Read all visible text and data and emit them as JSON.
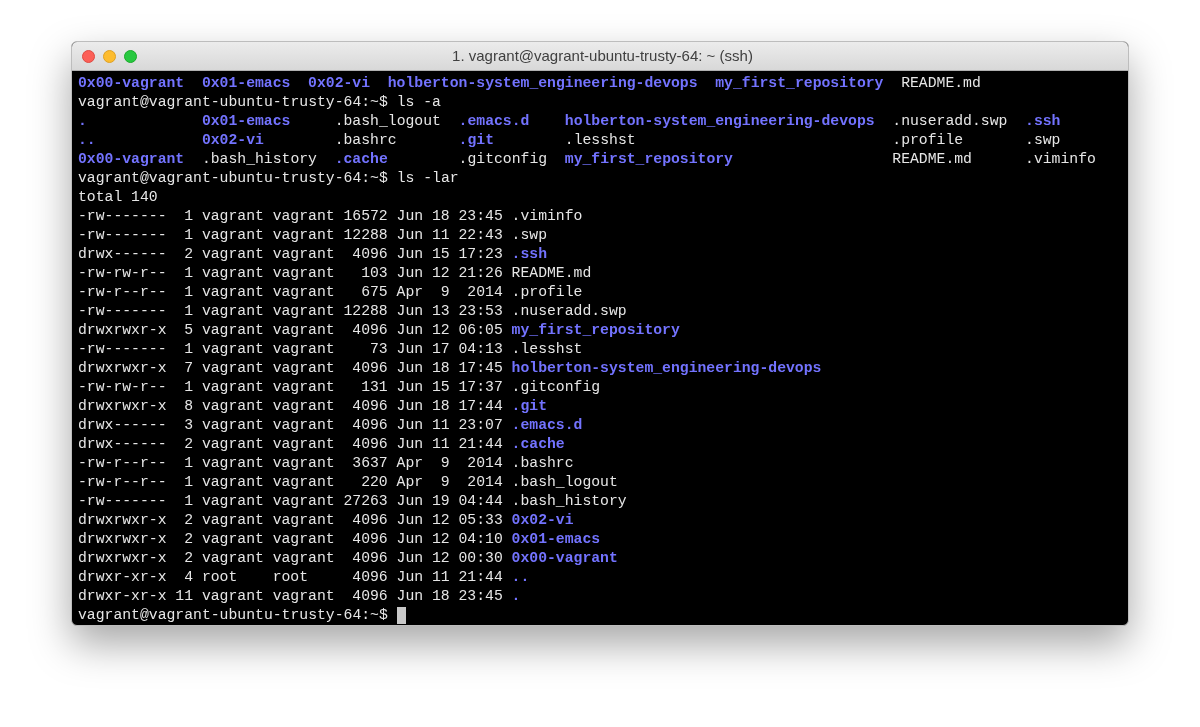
{
  "window": {
    "title": "1. vagrant@vagrant-ubuntu-trusty-64: ~ (ssh)"
  },
  "terminal": {
    "lines": [
      {
        "kind": "row",
        "items": [
          {
            "text": "0x00-vagrant",
            "dir": true
          },
          {
            "text": "0x01-emacs",
            "dir": true
          },
          {
            "text": "0x02-vi",
            "dir": true
          },
          {
            "text": "holberton-system_engineering-devops",
            "dir": true
          },
          {
            "text": "my_first_repository",
            "dir": true
          },
          {
            "text": "README.md",
            "dir": false
          }
        ]
      },
      {
        "kind": "prompt",
        "prompt": "vagrant@vagrant-ubuntu-trusty-64:~$",
        "command": "ls -a",
        "cursor": false
      },
      {
        "kind": "grid",
        "rows": [
          [
            {
              "text": ".",
              "dir": true
            },
            {
              "text": "0x01-emacs",
              "dir": true
            },
            {
              "text": ".bash_logout",
              "dir": false
            },
            {
              "text": ".emacs.d",
              "dir": true
            },
            {
              "text": "holberton-system_engineering-devops",
              "dir": true
            },
            {
              "text": ".nuseradd.swp",
              "dir": false
            },
            {
              "text": ".ssh",
              "dir": true
            }
          ],
          [
            {
              "text": "..",
              "dir": true
            },
            {
              "text": "0x02-vi",
              "dir": true
            },
            {
              "text": ".bashrc",
              "dir": false
            },
            {
              "text": ".git",
              "dir": true
            },
            {
              "text": ".lesshst",
              "dir": false
            },
            {
              "text": ".profile",
              "dir": false
            },
            {
              "text": ".swp",
              "dir": false
            }
          ],
          [
            {
              "text": "0x00-vagrant",
              "dir": true
            },
            {
              "text": ".bash_history",
              "dir": false
            },
            {
              "text": ".cache",
              "dir": true
            },
            {
              "text": ".gitconfig",
              "dir": false
            },
            {
              "text": "my_first_repository",
              "dir": true
            },
            {
              "text": "README.md",
              "dir": false
            },
            {
              "text": ".viminfo",
              "dir": false
            }
          ]
        ]
      },
      {
        "kind": "prompt",
        "prompt": "vagrant@vagrant-ubuntu-trusty-64:~$",
        "command": "ls -lar",
        "cursor": false
      },
      {
        "kind": "text",
        "text": "total 140"
      },
      {
        "kind": "long",
        "entries": [
          {
            "perms": "-rw-------",
            "links": "1",
            "owner": "vagrant",
            "group": "vagrant",
            "size": "16572",
            "date": "Jun 18 23:45",
            "name": ".viminfo",
            "dir": false
          },
          {
            "perms": "-rw-------",
            "links": "1",
            "owner": "vagrant",
            "group": "vagrant",
            "size": "12288",
            "date": "Jun 11 22:43",
            "name": ".swp",
            "dir": false
          },
          {
            "perms": "drwx------",
            "links": "2",
            "owner": "vagrant",
            "group": "vagrant",
            "size": "4096",
            "date": "Jun 15 17:23",
            "name": ".ssh",
            "dir": true
          },
          {
            "perms": "-rw-rw-r--",
            "links": "1",
            "owner": "vagrant",
            "group": "vagrant",
            "size": "103",
            "date": "Jun 12 21:26",
            "name": "README.md",
            "dir": false
          },
          {
            "perms": "-rw-r--r--",
            "links": "1",
            "owner": "vagrant",
            "group": "vagrant",
            "size": "675",
            "date": "Apr  9  2014",
            "name": ".profile",
            "dir": false
          },
          {
            "perms": "-rw-------",
            "links": "1",
            "owner": "vagrant",
            "group": "vagrant",
            "size": "12288",
            "date": "Jun 13 23:53",
            "name": ".nuseradd.swp",
            "dir": false
          },
          {
            "perms": "drwxrwxr-x",
            "links": "5",
            "owner": "vagrant",
            "group": "vagrant",
            "size": "4096",
            "date": "Jun 12 06:05",
            "name": "my_first_repository",
            "dir": true
          },
          {
            "perms": "-rw-------",
            "links": "1",
            "owner": "vagrant",
            "group": "vagrant",
            "size": "73",
            "date": "Jun 17 04:13",
            "name": ".lesshst",
            "dir": false
          },
          {
            "perms": "drwxrwxr-x",
            "links": "7",
            "owner": "vagrant",
            "group": "vagrant",
            "size": "4096",
            "date": "Jun 18 17:45",
            "name": "holberton-system_engineering-devops",
            "dir": true
          },
          {
            "perms": "-rw-rw-r--",
            "links": "1",
            "owner": "vagrant",
            "group": "vagrant",
            "size": "131",
            "date": "Jun 15 17:37",
            "name": ".gitconfig",
            "dir": false
          },
          {
            "perms": "drwxrwxr-x",
            "links": "8",
            "owner": "vagrant",
            "group": "vagrant",
            "size": "4096",
            "date": "Jun 18 17:44",
            "name": ".git",
            "dir": true
          },
          {
            "perms": "drwx------",
            "links": "3",
            "owner": "vagrant",
            "group": "vagrant",
            "size": "4096",
            "date": "Jun 11 23:07",
            "name": ".emacs.d",
            "dir": true
          },
          {
            "perms": "drwx------",
            "links": "2",
            "owner": "vagrant",
            "group": "vagrant",
            "size": "4096",
            "date": "Jun 11 21:44",
            "name": ".cache",
            "dir": true
          },
          {
            "perms": "-rw-r--r--",
            "links": "1",
            "owner": "vagrant",
            "group": "vagrant",
            "size": "3637",
            "date": "Apr  9  2014",
            "name": ".bashrc",
            "dir": false
          },
          {
            "perms": "-rw-r--r--",
            "links": "1",
            "owner": "vagrant",
            "group": "vagrant",
            "size": "220",
            "date": "Apr  9  2014",
            "name": ".bash_logout",
            "dir": false
          },
          {
            "perms": "-rw-------",
            "links": "1",
            "owner": "vagrant",
            "group": "vagrant",
            "size": "27263",
            "date": "Jun 19 04:44",
            "name": ".bash_history",
            "dir": false
          },
          {
            "perms": "drwxrwxr-x",
            "links": "2",
            "owner": "vagrant",
            "group": "vagrant",
            "size": "4096",
            "date": "Jun 12 05:33",
            "name": "0x02-vi",
            "dir": true
          },
          {
            "perms": "drwxrwxr-x",
            "links": "2",
            "owner": "vagrant",
            "group": "vagrant",
            "size": "4096",
            "date": "Jun 12 04:10",
            "name": "0x01-emacs",
            "dir": true
          },
          {
            "perms": "drwxrwxr-x",
            "links": "2",
            "owner": "vagrant",
            "group": "vagrant",
            "size": "4096",
            "date": "Jun 12 00:30",
            "name": "0x00-vagrant",
            "dir": true
          },
          {
            "perms": "drwxr-xr-x",
            "links": "4",
            "owner": "root",
            "group": "root",
            "size": "4096",
            "date": "Jun 11 21:44",
            "name": "..",
            "dir": true
          },
          {
            "perms": "drwxr-xr-x",
            "links": "11",
            "owner": "vagrant",
            "group": "vagrant",
            "size": "4096",
            "date": "Jun 18 23:45",
            "name": ".",
            "dir": true
          }
        ]
      },
      {
        "kind": "prompt",
        "prompt": "vagrant@vagrant-ubuntu-trusty-64:~$",
        "cursor": true
      }
    ]
  }
}
